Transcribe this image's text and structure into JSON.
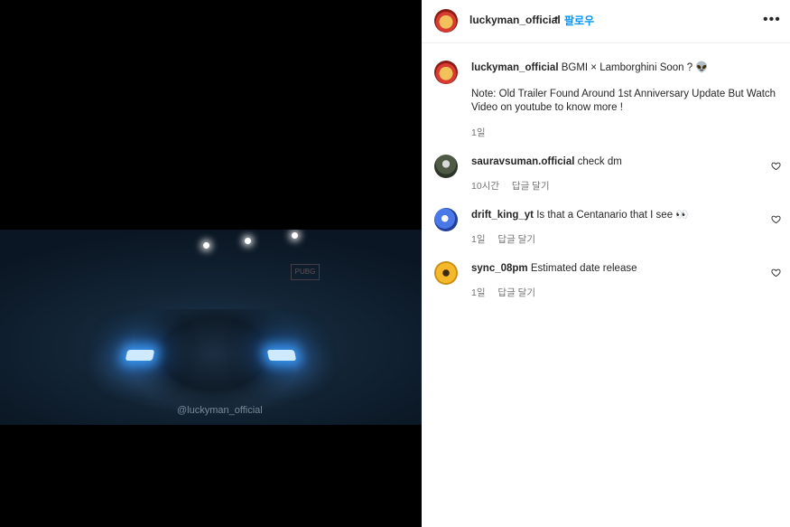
{
  "media": {
    "watermark": "@luckyman_official",
    "sign_text": "PUBG"
  },
  "header": {
    "username": "luckyman_official",
    "separator": "•",
    "follow_label": "팔로우",
    "more_icon": "more-options-icon",
    "more_glyph": "•••"
  },
  "caption": {
    "username": "luckyman_official",
    "text": "BGMI × Lamborghini Soon ? 👽",
    "note": "Note: Old Trailer Found Around 1st Anniversary Update But Watch Video on youtube to know more !",
    "time": "1일"
  },
  "comments": [
    {
      "username": "sauravsuman.official",
      "text": "check dm",
      "time": "10시간",
      "reply_label": "답글 달기"
    },
    {
      "username": "drift_king_yt",
      "text": "Is that a Centanario that I see 👀",
      "time": "1일",
      "reply_label": "답글 달기"
    },
    {
      "username": "sync_08pm",
      "text": "Estimated date release",
      "time": "1일",
      "reply_label": "답글 달기"
    }
  ],
  "colors": {
    "accent": "#0095f6",
    "muted": "#737373",
    "text": "#262626"
  }
}
